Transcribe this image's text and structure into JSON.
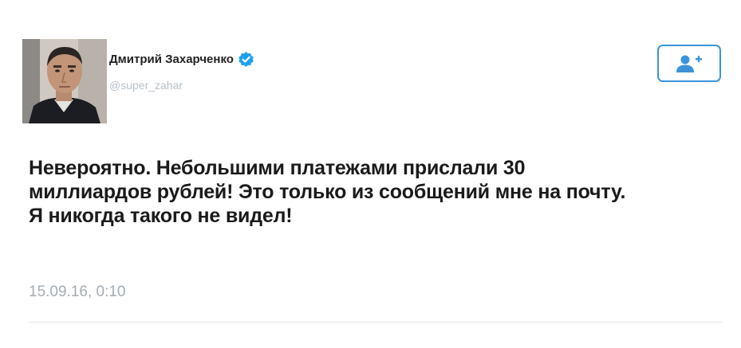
{
  "user": {
    "display_name": "Дмитрий Захарченко",
    "handle": "@super_zahar",
    "verified": true
  },
  "follow_button": {
    "icon": "add-user-icon",
    "color": "#3b94d9"
  },
  "tweet": {
    "text": "Невероятно. Небольшими платежами прислали 30 миллиардов рублей! Это только из сообщений мне на почту. Я никогда такого не видел!",
    "timestamp": "15.09.16, 0:10"
  },
  "colors": {
    "accent": "#3b94d9",
    "verified_badge": "#1da1f2",
    "muted_text": "#a3acb4"
  }
}
